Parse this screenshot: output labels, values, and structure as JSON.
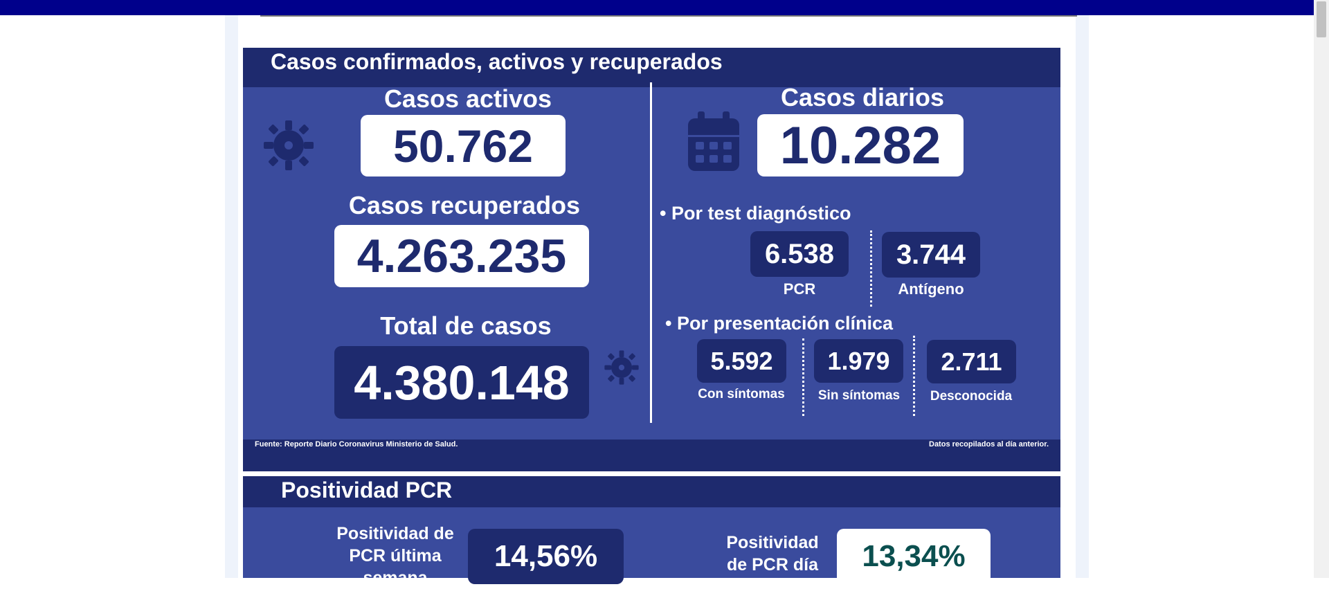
{
  "colors": {
    "accent": "#3a4b9d",
    "dark": "#1e2a6e",
    "topbar": "#00008b",
    "positivity_teal": "#0b4f4f"
  },
  "section1": {
    "title": "Casos confirmados, activos y recuperados",
    "active": {
      "label": "Casos activos",
      "value": "50.762"
    },
    "recovered": {
      "label": "Casos recuperados",
      "value": "4.263.235"
    },
    "total": {
      "label": "Total de casos",
      "value": "4.380.148"
    },
    "daily": {
      "label": "Casos diarios",
      "value": "10.282"
    },
    "by_test": {
      "label": "• Por test diagnóstico",
      "pcr": {
        "value": "6.538",
        "label": "PCR"
      },
      "antigen": {
        "value": "3.744",
        "label": "Antígeno"
      }
    },
    "by_clinical": {
      "label": "• Por presentación clínica",
      "symptoms": {
        "value": "5.592",
        "label": "Con síntomas"
      },
      "no_symptoms": {
        "value": "1.979",
        "label": "Sin síntomas"
      },
      "unknown": {
        "value": "2.711",
        "label": "Desconocida"
      }
    },
    "source": "Fuente: Reporte Diario Coronavirus Ministerio de Salud.",
    "collected": "Datos recopilados al día anterior."
  },
  "section2": {
    "title": "Positividad PCR",
    "week": {
      "label_lines": [
        "Positividad de",
        "PCR última",
        "semana"
      ],
      "value": "14,56%"
    },
    "day": {
      "label_lines": [
        "Positividad",
        "de PCR día"
      ],
      "value": "13,34%"
    }
  },
  "icons": [
    "virus-icon",
    "calendar-icon",
    "virus-small-icon"
  ]
}
